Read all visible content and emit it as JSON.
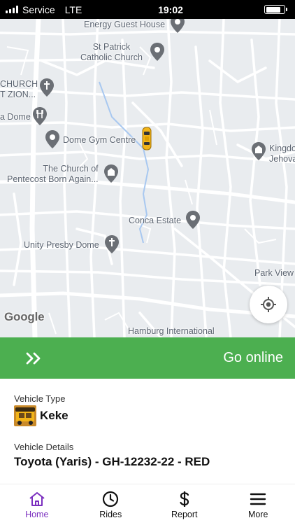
{
  "status_bar": {
    "carrier": "Service",
    "network": "LTE",
    "time": "19:02",
    "battery_level": 0.85
  },
  "map": {
    "pois": [
      {
        "name": "Energy Guest House"
      },
      {
        "name": "St Patrick\nCatholic Church"
      },
      {
        "name": "CHURCH\nT ZION..."
      },
      {
        "name": "a Dome"
      },
      {
        "name": "Dome Gym Centre"
      },
      {
        "name": "Kingdo\nJehova"
      },
      {
        "name": "The Church of\nPentecost Born Again..."
      },
      {
        "name": "Conca Estate"
      },
      {
        "name": "Unity Presby Dome"
      },
      {
        "name": "Park View"
      },
      {
        "name": "Hamburg International"
      }
    ],
    "attribution": "Google",
    "colors": {
      "land": "#e9ecef",
      "road": "#ffffff",
      "water": "#a8c8f0",
      "pin": "#6b6f75"
    }
  },
  "online_bar": {
    "label": "Go online",
    "icon": "double-chevron-right-icon",
    "color": "#4caf50"
  },
  "vehicle": {
    "type_label": "Vehicle Type",
    "type_value": "Keke",
    "details_label": "Vehicle Details",
    "details_value": "Toyota (Yaris) - GH-12232-22 - RED"
  },
  "nav": {
    "items": [
      {
        "label": "Home",
        "icon": "home-icon",
        "active": true
      },
      {
        "label": "Rides",
        "icon": "clock-icon",
        "active": false
      },
      {
        "label": "Report",
        "icon": "dollar-icon",
        "active": false
      },
      {
        "label": "More",
        "icon": "menu-icon",
        "active": false
      }
    ],
    "active_color": "#7b2fbf"
  }
}
